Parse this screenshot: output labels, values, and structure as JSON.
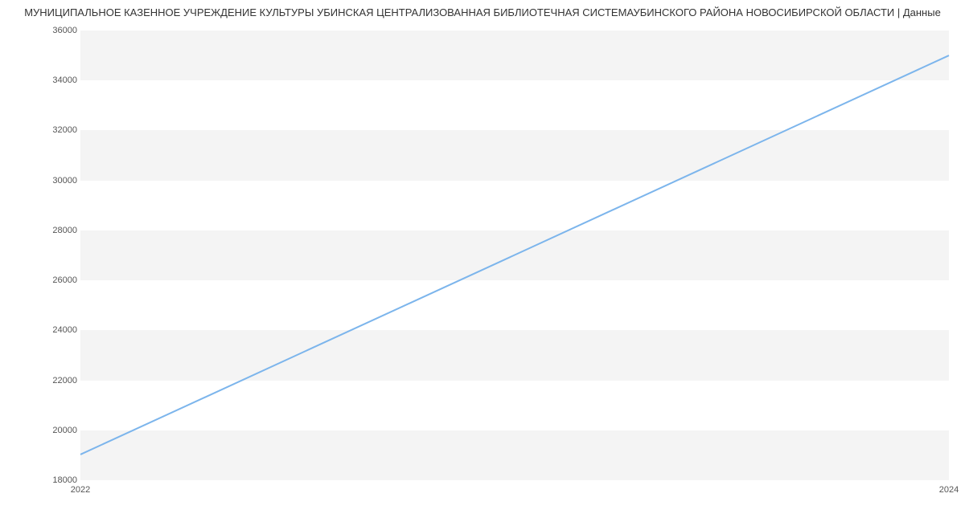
{
  "chart_data": {
    "type": "line",
    "title": "МУНИЦИПАЛЬНОЕ КАЗЕННОЕ УЧРЕЖДЕНИЕ КУЛЬТУРЫ УБИНСКАЯ ЦЕНТРАЛИЗОВАННАЯ БИБЛИОТЕЧНАЯ СИСТЕМАУБИНСКОГО РАЙОНА НОВОСИБИРСКОЙ ОБЛАСТИ | Данные",
    "x": [
      2022,
      2024
    ],
    "series": [
      {
        "name": "series-1",
        "values": [
          19000,
          35000
        ],
        "color": "#7cb5ec"
      }
    ],
    "xlabel": "",
    "ylabel": "",
    "ylim": [
      18000,
      36000
    ],
    "xlim": [
      2022,
      2024
    ],
    "y_ticks": [
      18000,
      20000,
      22000,
      24000,
      26000,
      28000,
      30000,
      32000,
      34000,
      36000
    ],
    "x_ticks": [
      2022,
      2024
    ],
    "y_bands": [
      [
        18000,
        20000
      ],
      [
        22000,
        24000
      ],
      [
        26000,
        28000
      ],
      [
        30000,
        32000
      ],
      [
        34000,
        36000
      ]
    ]
  }
}
